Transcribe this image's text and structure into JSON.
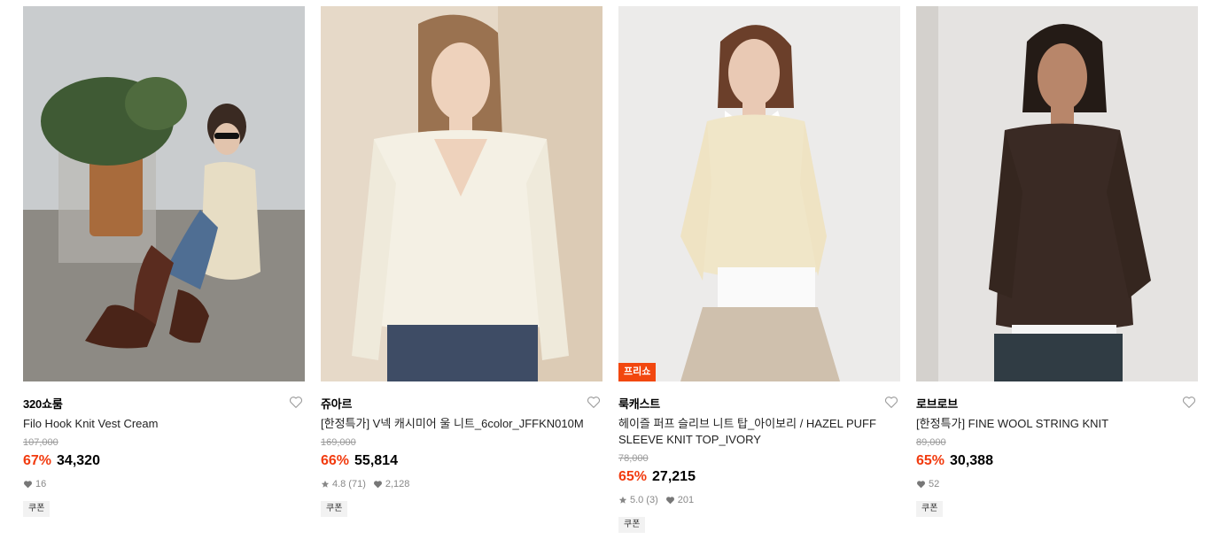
{
  "products": [
    {
      "brand": "320쇼룸",
      "title": "Filo Hook Knit Vest Cream",
      "original_price": "107,000",
      "discount": "67%",
      "price": "34,320",
      "likes": "16",
      "coupon": "쿠폰",
      "image": "model-seated-knit-vest"
    },
    {
      "brand": "쥬아르",
      "title": "[한정특가] V넥 캐시미어 울 니트_6color_JFFKN010M",
      "original_price": "169,000",
      "discount": "66%",
      "price": "55,814",
      "rating": "4.8",
      "reviews": "(71)",
      "likes": "2,128",
      "coupon": "쿠폰",
      "image": "model-cream-vneck-knit"
    },
    {
      "brand": "룩캐스트",
      "badge": "프리쇼",
      "title": "헤이즐 퍼프 슬리브 니트 탑_아이보리 / HAZEL PUFF SLEEVE KNIT TOP_IVORY",
      "original_price": "78,000",
      "discount": "65%",
      "price": "27,215",
      "rating": "5.0",
      "reviews": "(3)",
      "likes": "201",
      "coupon": "쿠폰",
      "image": "model-ivory-knit-top"
    },
    {
      "brand": "로브로브",
      "title": "[한정특가] FINE WOOL STRING KNIT",
      "original_price": "89,000",
      "discount": "65%",
      "price": "30,388",
      "likes": "52",
      "coupon": "쿠폰",
      "image": "model-brown-wool-knit"
    }
  ],
  "colors": {
    "discount": "#f23b0f",
    "badge": "#f2470f"
  },
  "icons": {
    "wishlist": "heart-outline-icon",
    "rating": "star-icon",
    "likes": "heart-filled-icon"
  }
}
